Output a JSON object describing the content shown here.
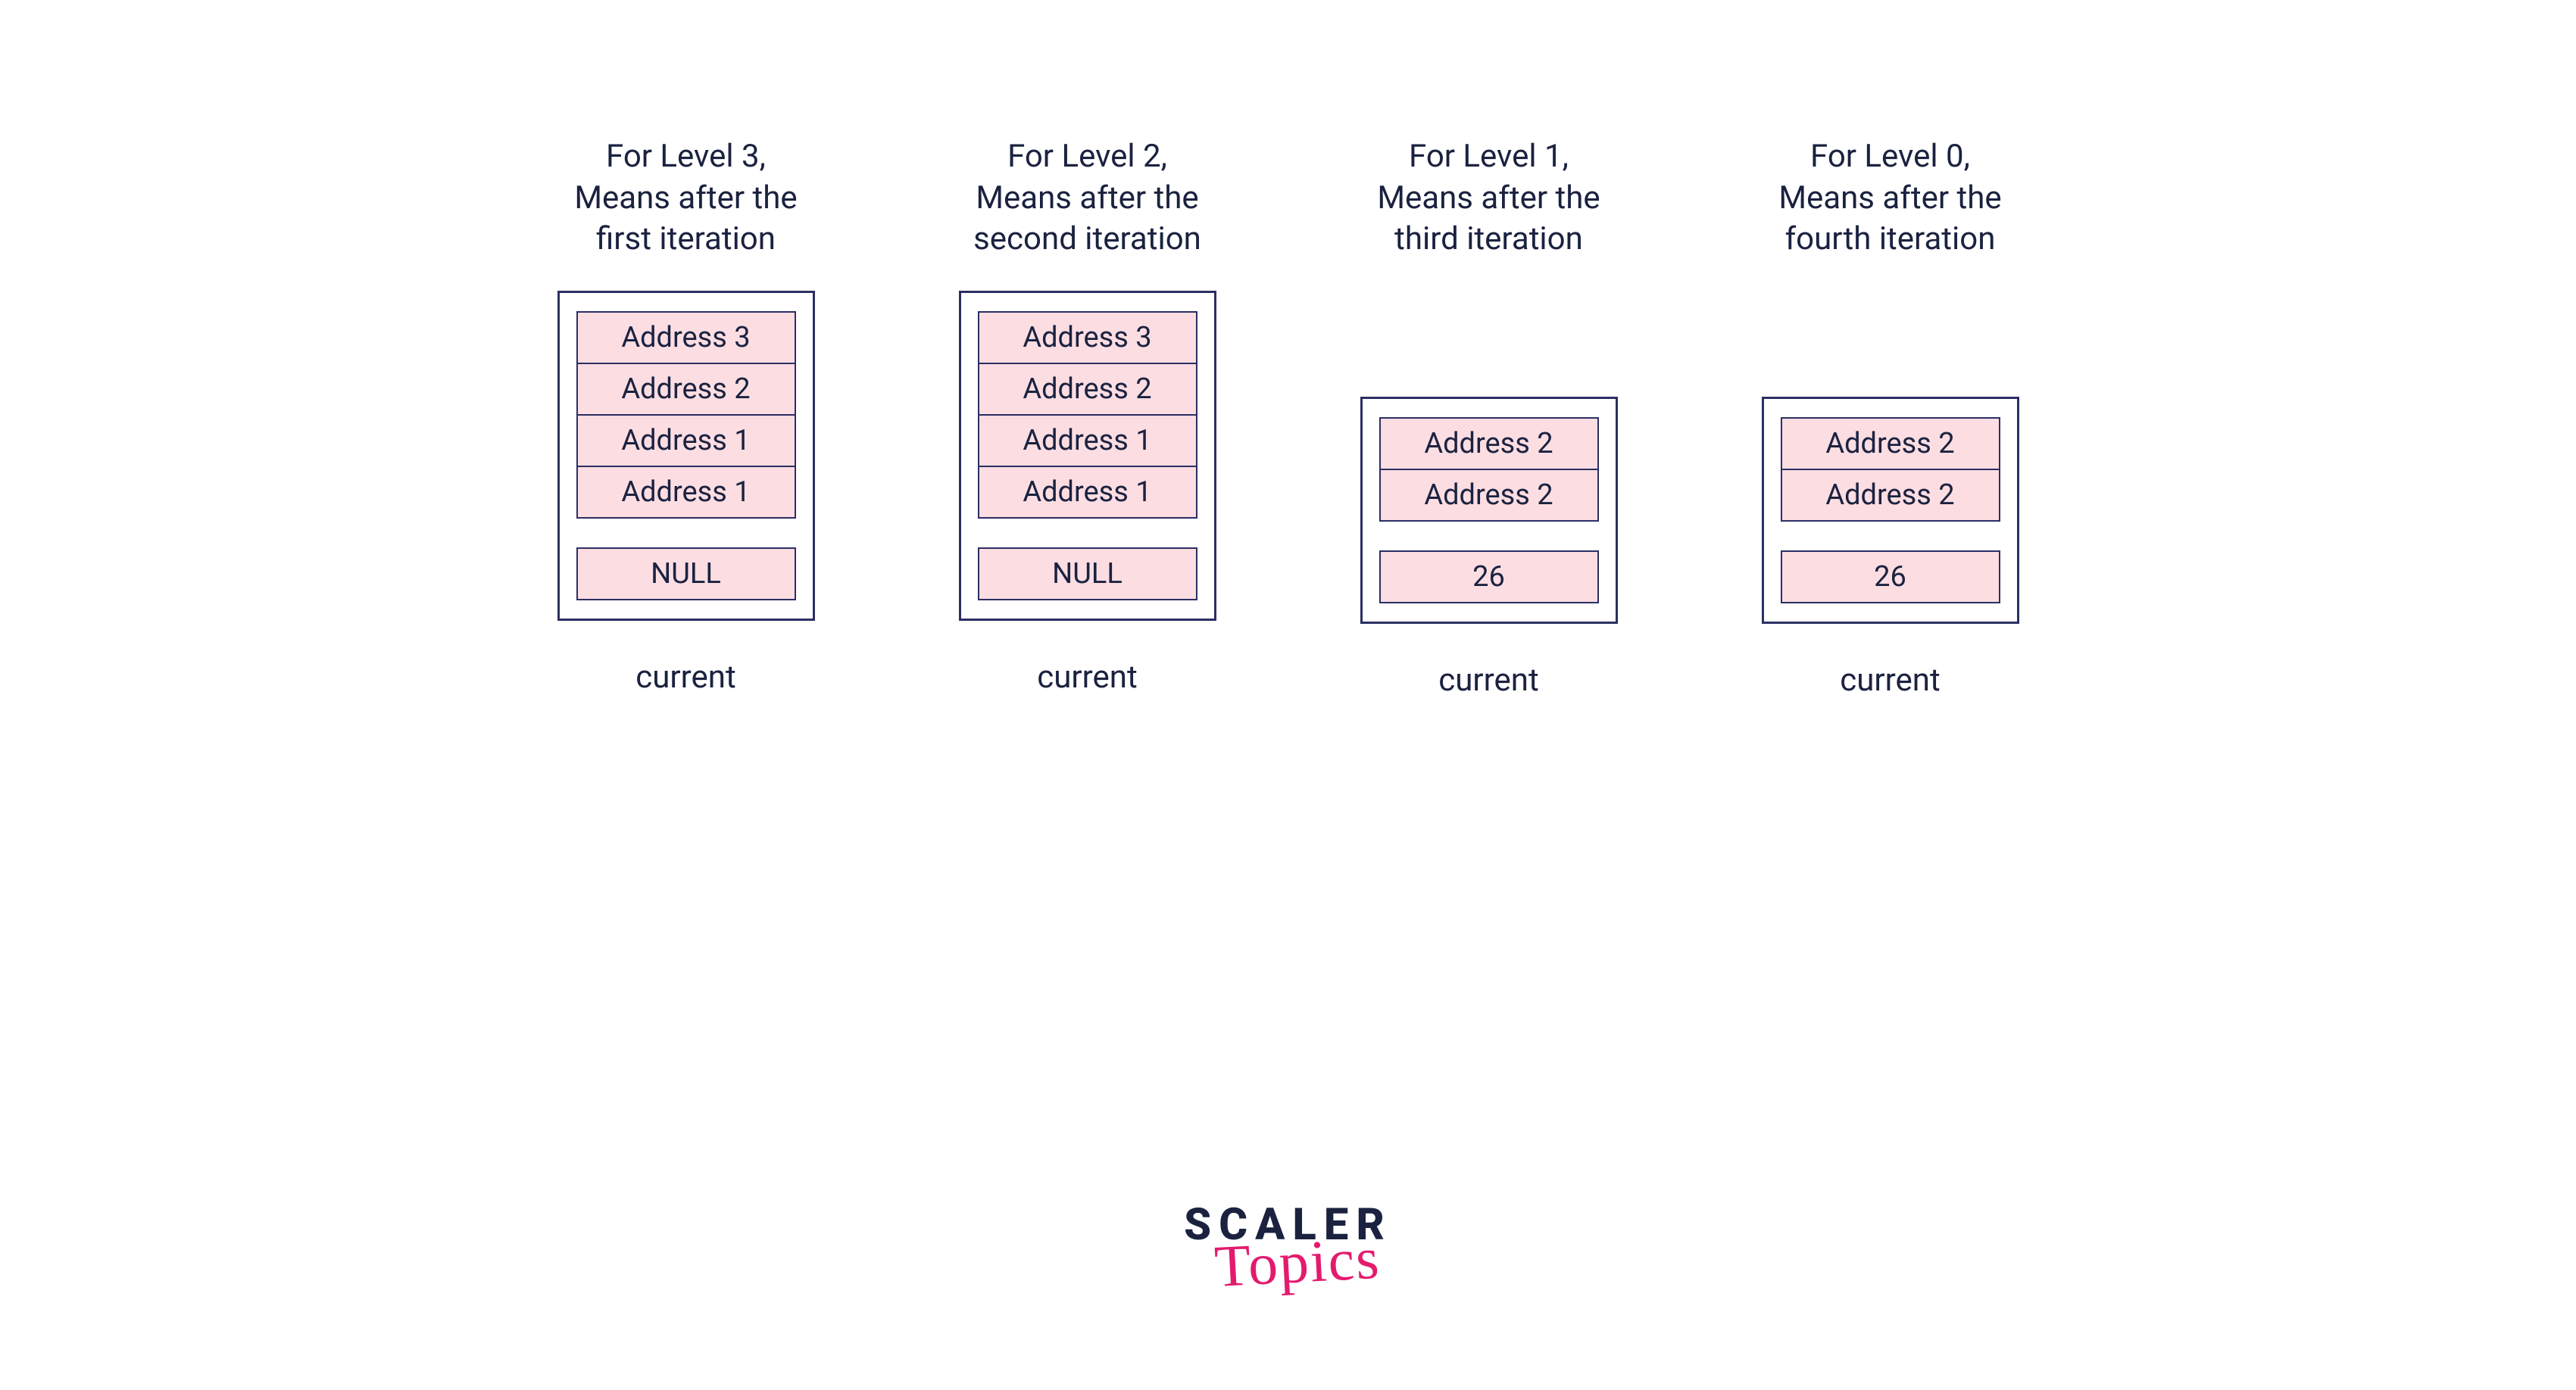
{
  "columns": [
    {
      "header": "For Level 3,\nMeans after the\nfirst iteration",
      "cells": [
        "Address 3",
        "Address 2",
        "Address 1",
        "Address 1"
      ],
      "value": "NULL",
      "footer": "current"
    },
    {
      "header": "For Level 2,\nMeans after the\nsecond iteration",
      "cells": [
        "Address 3",
        "Address 2",
        "Address 1",
        "Address 1"
      ],
      "value": "NULL",
      "footer": "current"
    },
    {
      "header": "For Level 1,\nMeans after the\nthird iteration",
      "cells": [
        "Address 2",
        "Address 2"
      ],
      "value": "26",
      "footer": "current"
    },
    {
      "header": "For Level 0,\nMeans after the\nfourth iteration",
      "cells": [
        "Address 2",
        "Address 2"
      ],
      "value": "26",
      "footer": "current"
    }
  ],
  "logo": {
    "main": "SCALER",
    "sub": "Topics"
  }
}
